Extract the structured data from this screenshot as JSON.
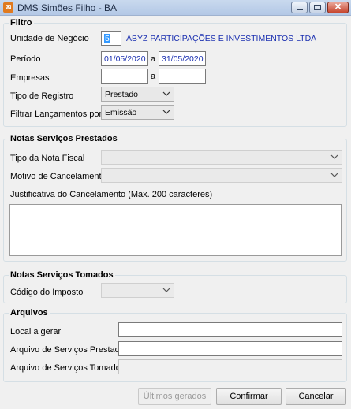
{
  "window": {
    "title": "DMS Simões Filho - BA",
    "close_glyph": "✕"
  },
  "filtro": {
    "title": "Filtro",
    "unidade_label": "Unidade de Negócio",
    "unidade_code": "5",
    "unidade_name": "ABYZ PARTICIPAÇÕES E INVESTIMENTOS LTDA",
    "periodo_label": "Período",
    "periodo_from": "01/05/2020",
    "periodo_to": "31/05/2020",
    "range_sep": "a",
    "empresas_label": "Empresas",
    "empresas_from": "",
    "empresas_to": "",
    "tipo_registro_label": "Tipo de Registro",
    "tipo_registro_value": "Prestado",
    "filtrar_label": "Filtrar Lançamentos por",
    "filtrar_value": "Emissão"
  },
  "prestados": {
    "title": "Notas Serviços Prestados",
    "tipo_nota_label": "Tipo da Nota Fiscal",
    "tipo_nota_value": "",
    "motivo_label": "Motivo de Cancelamento",
    "motivo_value": "",
    "justificativa_label": "Justificativa do Cancelamento (Max. 200 caracteres)",
    "justificativa_value": ""
  },
  "tomados": {
    "title": "Notas Serviços Tomados",
    "codigo_label": "Código do Imposto",
    "codigo_value": ""
  },
  "arquivos": {
    "title": "Arquivos",
    "local_label": "Local a gerar",
    "local_value": "",
    "prestados_label": "Arquivo de Serviços Prestados",
    "prestados_value": "",
    "tomados_label": "Arquivo de Serviços Tomados",
    "tomados_value": ""
  },
  "buttons": {
    "ultimos_mnemonic": "Ú",
    "ultimos_rest": "ltimos gerados",
    "confirmar_mnemonic": "C",
    "confirmar_rest": "onfirmar",
    "cancelar_main": "Cancela",
    "cancelar_mnemonic": "r"
  }
}
